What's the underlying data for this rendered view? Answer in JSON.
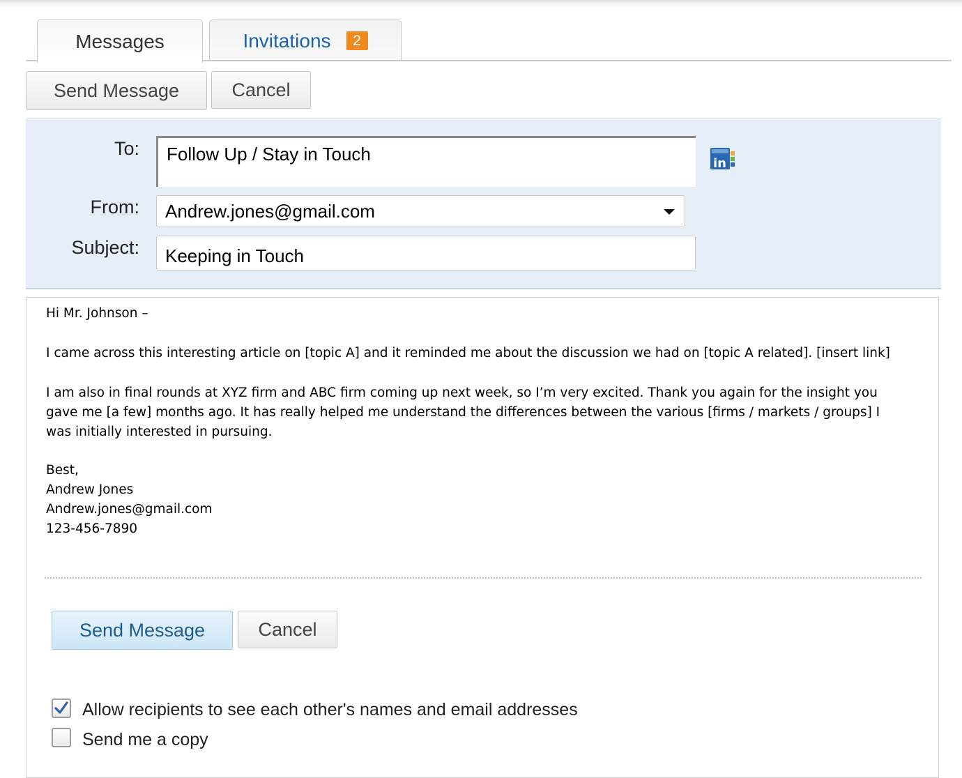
{
  "tabs": [
    {
      "label": "Messages",
      "active": true
    },
    {
      "label": "Invitations",
      "badge": "2"
    }
  ],
  "toolbar": {
    "send_label": "Send Message",
    "cancel_label": "Cancel"
  },
  "header": {
    "to_label": "To:",
    "to_value": "Follow Up / Stay in Touch",
    "from_label": "From:",
    "from_value": "Andrew.jones@gmail.com",
    "subject_label": "Subject:",
    "subject_value": "Keeping in Touch"
  },
  "message": {
    "greeting": "Hi Mr. Johnson –",
    "p1": "I came across this interesting article on [topic A] and it reminded me about the discussion we had on [topic A related]. [insert link]",
    "p2": "I am also in final rounds at XYZ firm and ABC firm coming up next week, so I’m very excited. Thank you again for the insight you gave me [a few] months ago. It has really helped me understand the differences between the various [firms / markets / groups] I was initially interested in pursuing.",
    "signoff": "Best,",
    "name": "Andrew Jones",
    "email": "Andrew.jones@gmail.com",
    "phone": "123-456-7890"
  },
  "footer": {
    "send_label": "Send Message",
    "cancel_label": "Cancel"
  },
  "options": [
    {
      "label": "Allow recipients to see each other's names and email addresses",
      "checked": true
    },
    {
      "label": "Send me a copy",
      "checked": false
    }
  ],
  "colors": {
    "accent": "#1a63a8",
    "badge": "#f08a1c",
    "panel": "#e6eff8",
    "linkedin": "#2867b2"
  },
  "icons": {
    "linkedin": "linkedin-contacts-icon",
    "dropdown": "chevron-down-icon",
    "check": "checkmark-icon"
  }
}
